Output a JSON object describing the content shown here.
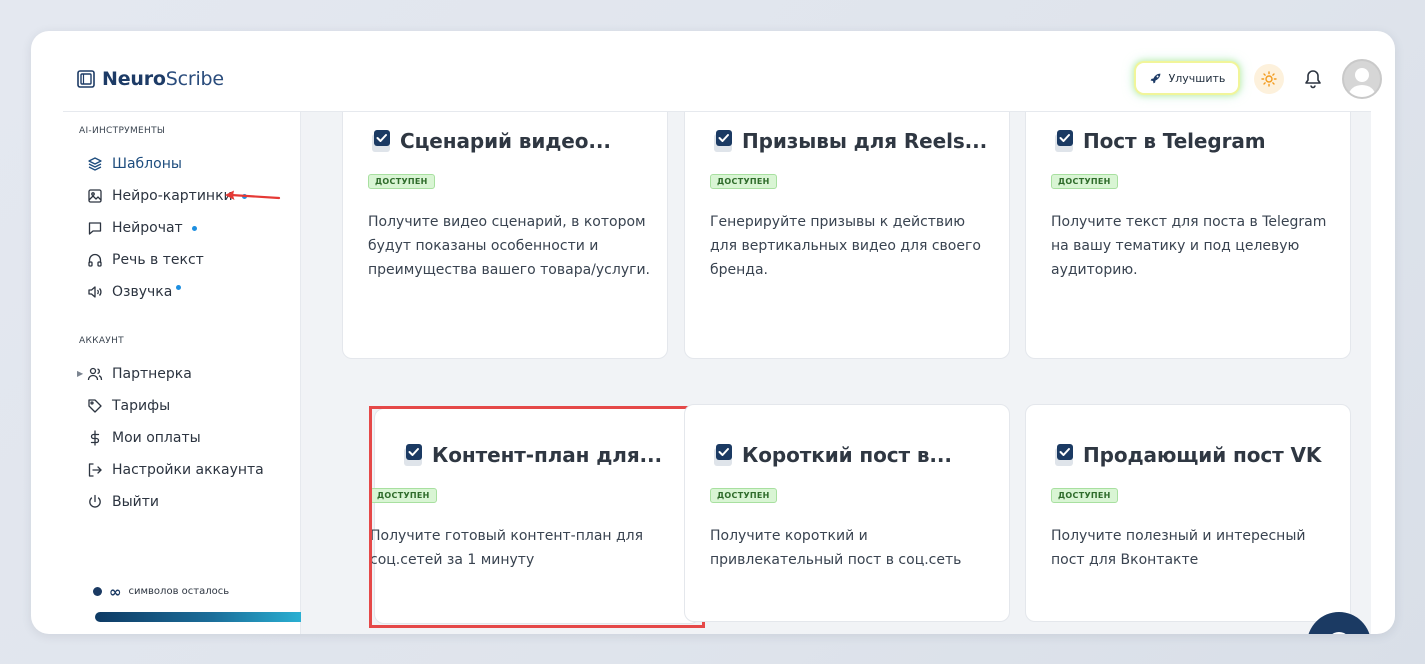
{
  "brand": {
    "name_bold": "Neuro",
    "name_rest": "Scribe"
  },
  "header": {
    "upgrade_label": "Улучшить"
  },
  "sidebar": {
    "ai_section": "AI-ИНСТРУМЕНТЫ",
    "ai_items": [
      {
        "label": "Шаблоны",
        "icon": "layers-icon",
        "active": true
      },
      {
        "label": "Нейро-картинки",
        "icon": "image-icon",
        "dot": true
      },
      {
        "label": "Нейрочат",
        "icon": "chat-icon",
        "dot": true
      },
      {
        "label": "Речь в текст",
        "icon": "headphones-icon"
      },
      {
        "label": "Озвучка",
        "icon": "speaker-icon",
        "dot": true
      }
    ],
    "account_section": "АККАУНТ",
    "account_items": [
      {
        "label": "Партнерка",
        "icon": "users-icon"
      },
      {
        "label": "Тарифы",
        "icon": "tag-icon"
      },
      {
        "label": "Мои оплаты",
        "icon": "dollar-icon"
      },
      {
        "label": "Настройки аккаунта",
        "icon": "logout-arrow-icon"
      },
      {
        "label": "Выйти",
        "icon": "power-icon"
      }
    ],
    "quota_symbol": "∞",
    "quota_text": "символов осталось"
  },
  "cards": [
    {
      "title": "Сценарий видео...",
      "badge": "ДОСТУПЕН",
      "desc": "Получите видео сценарий, в котором будут показаны особенности и преимущества вашего товара/услуги."
    },
    {
      "title": "Призывы для Reels...",
      "badge": "ДОСТУПЕН",
      "desc": "Генерируйте призывы к действию для вертикальных видео для своего бренда."
    },
    {
      "title": "Пост в Telegram",
      "badge": "ДОСТУПЕН",
      "desc": "Получите текст для поста в Telegram на вашу тематику и под целевую аудиторию."
    },
    {
      "title": "Контент-план для...",
      "badge": "ДОСТУПЕН",
      "desc": "Получите готовый контент-план для соц.сетей за 1 минуту"
    },
    {
      "title": "Короткий пост в...",
      "badge": "ДОСТУПЕН",
      "desc": "Получите короткий и привлекательный пост в соц.сеть"
    },
    {
      "title": "Продающий пост VK",
      "badge": "ДОСТУПЕН",
      "desc": "Получите полезный и интересный пост для Вконтакте"
    }
  ],
  "colors": {
    "accent": "#1e4d7e",
    "badge_bg": "#d9f5d4",
    "highlight": "#e54848",
    "annotation_arrow": "#e53935"
  }
}
